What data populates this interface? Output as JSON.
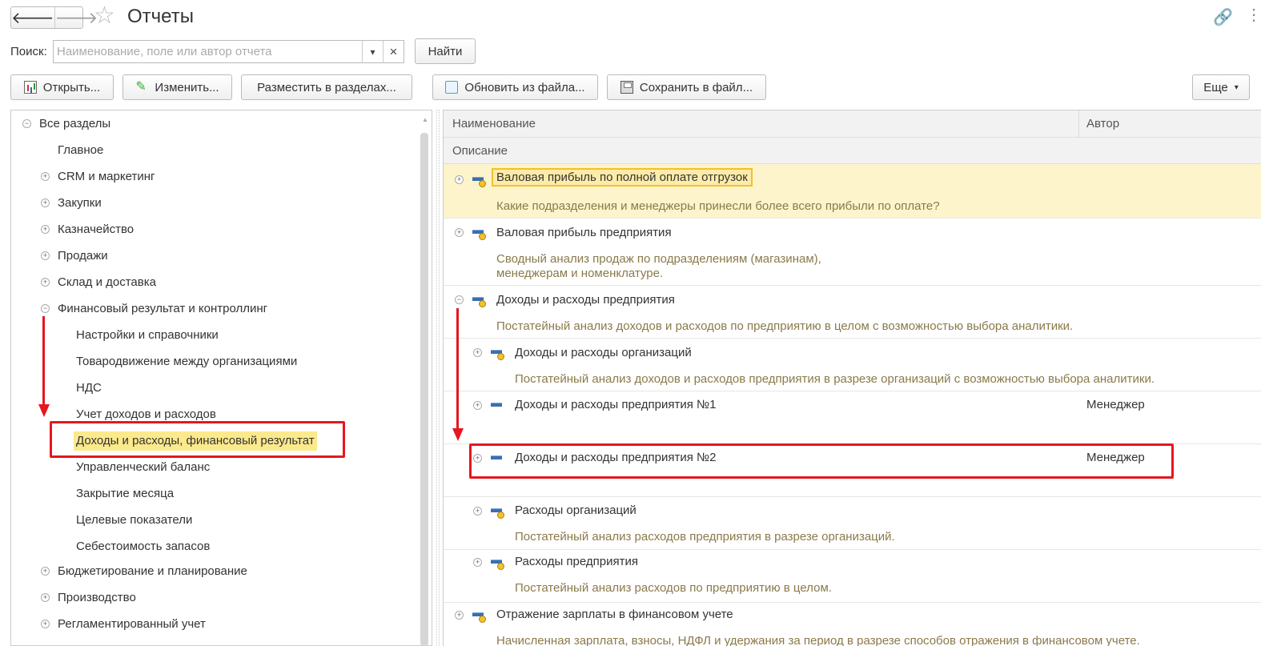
{
  "window": {
    "title": "Отчеты"
  },
  "nav": {
    "back": "🡐",
    "forward": "🡒"
  },
  "search": {
    "label": "Поиск:",
    "placeholder": "Наименование, поле или автор отчета",
    "dropdown_glyph": "▾",
    "clear_glyph": "×",
    "find_label": "Найти"
  },
  "toolbar": {
    "open": "Открыть...",
    "edit": "Изменить...",
    "place": "Разместить в разделах...",
    "update": "Обновить из файла...",
    "save": "Сохранить в файл...",
    "more": "Еще"
  },
  "tree": {
    "root": "Все разделы",
    "items": [
      {
        "label": "Главное"
      },
      {
        "label": "CRM и маркетинг"
      },
      {
        "label": "Закупки"
      },
      {
        "label": "Казначейство"
      },
      {
        "label": "Продажи"
      },
      {
        "label": "Склад и доставка"
      },
      {
        "label": "Финансовый результат и контроллинг"
      },
      {
        "label": "Настройки и справочники"
      },
      {
        "label": "Товародвижение между организациями"
      },
      {
        "label": "НДС"
      },
      {
        "label": "Учет доходов и расходов"
      },
      {
        "label": "Доходы и расходы, финансовый результат"
      },
      {
        "label": "Управленческий баланс"
      },
      {
        "label": "Закрытие месяца"
      },
      {
        "label": "Целевые показатели"
      },
      {
        "label": "Себестоимость запасов"
      },
      {
        "label": "Бюджетирование и планирование"
      },
      {
        "label": "Производство"
      },
      {
        "label": "Регламентированный учет"
      }
    ]
  },
  "grid": {
    "col_name": "Наименование",
    "col_author": "Автор",
    "col_desc": "Описание",
    "rows": [
      {
        "name": "Валовая прибыль по полной оплате отгрузок",
        "desc": "Какие подразделения и менеджеры принесли более всего прибыли по оплате?",
        "author": ""
      },
      {
        "name": "Валовая прибыль предприятия",
        "desc": "Сводный анализ продаж по подразделениям (магазинам), менеджерам и номенклатуре.",
        "author": ""
      },
      {
        "name": "Доходы и расходы предприятия",
        "desc": "Постатейный анализ доходов и расходов по предприятию в целом с возможностью выбора аналитики.",
        "author": ""
      },
      {
        "name": "Доходы и расходы организаций",
        "desc": "Постатейный анализ доходов и расходов предприятия в разрезе организаций с возможностью выбора аналитики.",
        "author": ""
      },
      {
        "name": "Доходы и расходы предприятия  №1",
        "desc": "",
        "author": "Менеджер"
      },
      {
        "name": "Доходы и расходы предприятия  №2",
        "desc": "",
        "author": "Менеджер"
      },
      {
        "name": "Расходы организаций",
        "desc": "Постатейный анализ расходов предприятия в разрезе организаций.",
        "author": ""
      },
      {
        "name": "Расходы предприятия",
        "desc": "Постатейный анализ расходов по предприятию в целом.",
        "author": ""
      },
      {
        "name": "Отражение зарплаты в финансовом учете",
        "desc": "Начисленная зарплата, взносы, НДФЛ и удержания за период в разрезе способов отражения в финансовом учете.",
        "author": ""
      }
    ]
  },
  "colors": {
    "highlight": "#fdf4cc",
    "selection": "#fbe98c",
    "annotation": "#e5171f"
  }
}
